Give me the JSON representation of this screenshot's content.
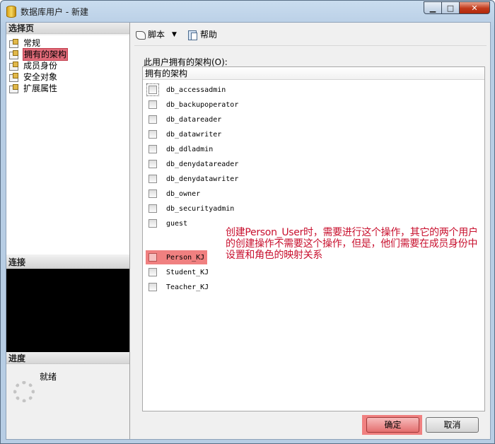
{
  "window": {
    "title": "数据库用户 - 新建",
    "buttons": {
      "minimize": "▁",
      "maximize": "□",
      "close": "✕"
    }
  },
  "left": {
    "select_page_header": "选择页",
    "pages": [
      {
        "label": "常规",
        "selected": false
      },
      {
        "label": "拥有的架构",
        "selected": true
      },
      {
        "label": "成员身份",
        "selected": false
      },
      {
        "label": "安全对象",
        "selected": false
      },
      {
        "label": "扩展属性",
        "selected": false
      }
    ],
    "connection_header": "连接",
    "progress_header": "进度",
    "progress_status": "就绪"
  },
  "toolbar": {
    "script_label": "脚本",
    "help_label": "帮助"
  },
  "schemas": {
    "group_label": "此用户拥有的架构(O):",
    "column_header": "拥有的架构",
    "items": [
      {
        "name": "db_accessadmin",
        "checked": false
      },
      {
        "name": "db_backupoperator",
        "checked": false
      },
      {
        "name": "db_datareader",
        "checked": false
      },
      {
        "name": "db_datawriter",
        "checked": false
      },
      {
        "name": "db_ddladmin",
        "checked": false
      },
      {
        "name": "db_denydatareader",
        "checked": false
      },
      {
        "name": "db_denydatawriter",
        "checked": false
      },
      {
        "name": "db_owner",
        "checked": false
      },
      {
        "name": "db_securityadmin",
        "checked": false
      },
      {
        "name": "guest",
        "checked": false
      },
      {
        "name": "Person_KJ",
        "checked": false
      },
      {
        "name": "Student_KJ",
        "checked": false
      },
      {
        "name": "Teacher_KJ",
        "checked": false
      }
    ]
  },
  "annotation": "创建Person_User时，需要进行这个操作，其它的两个用户的创建操作不需要这个操作，但是，他们需要在成员身份中设置和角色的映射关系",
  "buttons": {
    "ok": "确定",
    "cancel": "取消"
  },
  "colors": {
    "highlight": "#f08080",
    "annotation_text": "#c8102e"
  }
}
